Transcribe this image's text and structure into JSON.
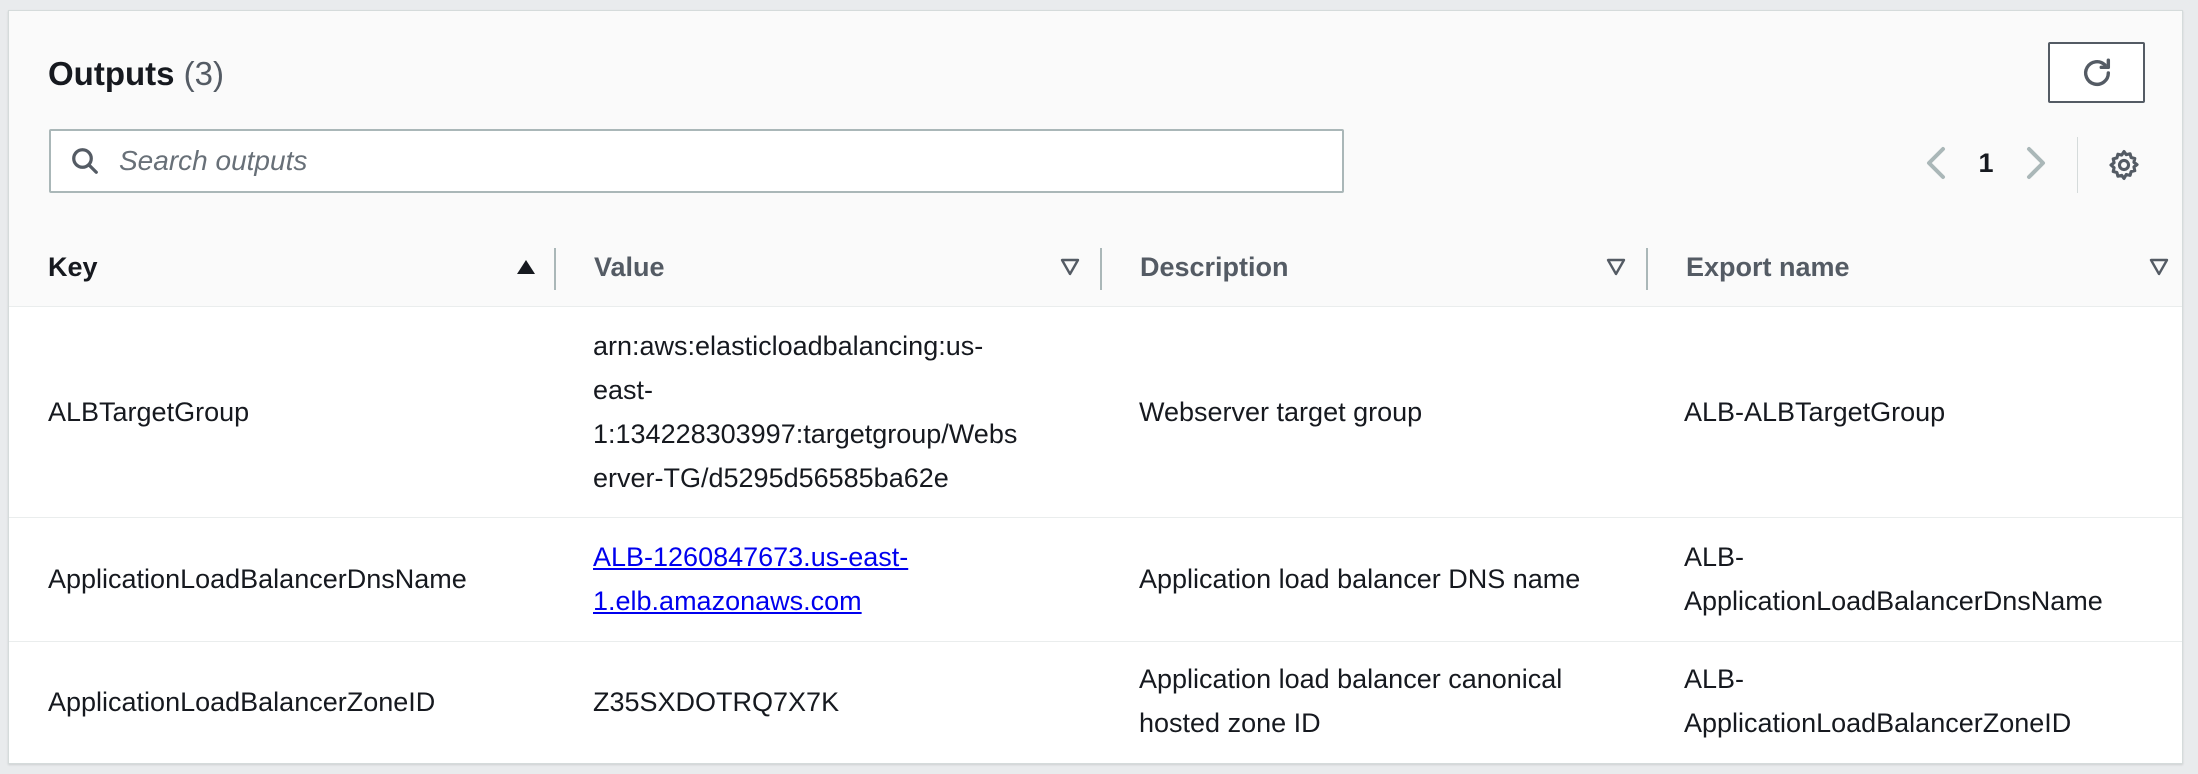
{
  "header": {
    "title": "Outputs",
    "count": "(3)"
  },
  "search": {
    "placeholder": "Search outputs",
    "value": ""
  },
  "pagination": {
    "current_page": "1"
  },
  "icons": {
    "refresh": "refresh-icon",
    "search": "search-icon",
    "prev": "chevron-left-icon",
    "next": "chevron-right-icon",
    "settings": "gear-icon",
    "sort_ascending": "caret-up-icon",
    "sortable": "caret-down-outline-icon"
  },
  "columns": [
    {
      "label": "Key"
    },
    {
      "label": "Value"
    },
    {
      "label": "Description"
    },
    {
      "label": "Export name"
    }
  ],
  "rows": [
    {
      "key": "ALBTargetGroup",
      "value": "arn:aws:elasticloadbalancing:us-east-1:134228303997:targetgroup/Webserver-TG/d5295d56585ba62e",
      "value_lines": [
        "arn:aws:elasticloadbalancing:us-",
        "east-",
        "1:134228303997:targetgroup/Webs",
        "erver-TG/d5295d56585ba62e"
      ],
      "description": "Webserver target group",
      "export_name": "ALB-ALBTargetGroup"
    },
    {
      "key": "ApplicationLoadBalancerDnsName",
      "value_lines": [
        "ALB-1260847673.us-east-",
        "1.elb.amazonaws.com"
      ],
      "description": "Application load balancer DNS name",
      "export_name_lines": [
        "ALB-",
        "ApplicationLoadBalancerDnsName"
      ]
    },
    {
      "key": "ApplicationLoadBalancerZoneID",
      "value": "Z35SXDOTRQ7X7K",
      "description_lines": [
        "Application load balancer canonical",
        "hosted zone ID"
      ],
      "export_name_lines": [
        "ALB-",
        "ApplicationLoadBalancerZoneID"
      ]
    }
  ],
  "colors": {
    "text": "#16191f",
    "muted": "#545b64",
    "link": "#0000ee",
    "border": "#aab7b8"
  }
}
